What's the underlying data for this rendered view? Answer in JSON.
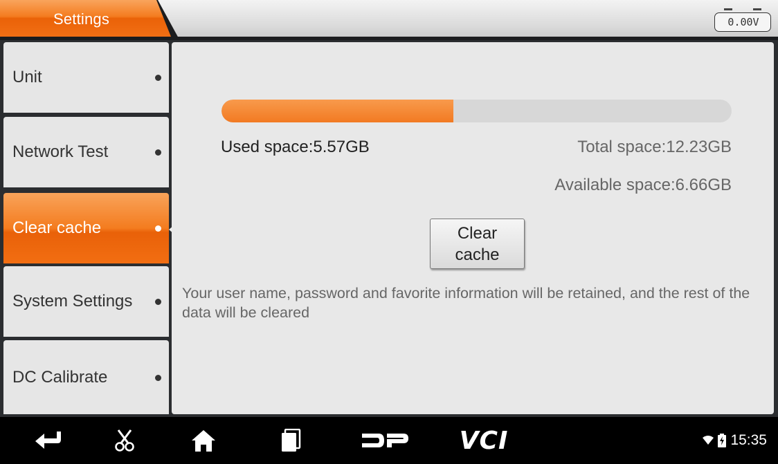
{
  "header": {
    "tab_label": "Settings",
    "voltage": "0.00V"
  },
  "sidebar": {
    "items": [
      {
        "label": "Unit",
        "active": false
      },
      {
        "label": "Network Test",
        "active": false
      },
      {
        "label": "Clear cache",
        "active": true
      },
      {
        "label": "System Settings",
        "active": false
      },
      {
        "label": "DC Calibrate",
        "active": false
      }
    ]
  },
  "storage": {
    "used_fraction": 0.455,
    "used_text": "Used space:5.57GB",
    "total_text": "Total space:12.23GB",
    "available_text": "Available space:6.66GB",
    "clear_button_label": "Clear cache",
    "notice": "Your user name, password and favorite information will be retained, and the rest of the data will be cleared"
  },
  "navbar": {
    "icons": [
      "back-icon",
      "scissors-icon",
      "home-icon",
      "recent-apps-icon",
      "dp-logo-icon",
      "vci-icon"
    ],
    "vci_label": "VCI",
    "time": "15:35"
  },
  "colors": {
    "accent": "#f47c1f",
    "panel": "#e8e8e8",
    "nav_bg": "#000000"
  }
}
